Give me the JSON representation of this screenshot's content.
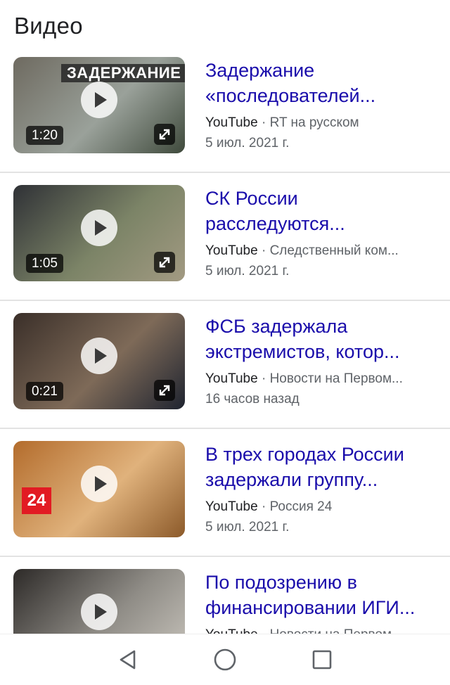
{
  "section_title": "Видео",
  "videos": [
    {
      "title": "Задержание «последователей...",
      "source": "YouTube",
      "channel": "RT на русском",
      "date": "5 июл. 2021 г.",
      "duration": "1:20",
      "banner": "ЗАДЕРЖАНИЕ",
      "thumb_colors": [
        "#6e6a60",
        "#9aa19a",
        "#3f4a3c"
      ]
    },
    {
      "title": "СК России расследуются...",
      "source": "YouTube",
      "channel": "Следственный ком...",
      "date": "5 июл. 2021 г.",
      "duration": "1:05",
      "banner": "",
      "thumb_colors": [
        "#2f3136",
        "#7c8467",
        "#a29a82"
      ]
    },
    {
      "title": "ФСБ задержала экстремистов, котор...",
      "source": "YouTube",
      "channel": "Новости на Первом...",
      "date": "16 часов назад",
      "duration": "0:21",
      "banner": "",
      "thumb_colors": [
        "#3a2f29",
        "#7e6a58",
        "#1f2430"
      ]
    },
    {
      "title": "В трех городах России задержали группу...",
      "source": "YouTube",
      "channel": "Россия 24",
      "date": "5 июл. 2021 г.",
      "duration": "",
      "banner": "",
      "badge": "24",
      "thumb_colors": [
        "#b36c2c",
        "#e0b27c",
        "#8c5a2a"
      ]
    },
    {
      "title": "По подозрению в финансировании ИГИ...",
      "source": "YouTube",
      "channel": "Новости на Первом...",
      "date": "",
      "duration": "",
      "banner": "",
      "thumb_colors": [
        "#2d2a28",
        "#8f8c86",
        "#c9c5bd"
      ]
    }
  ],
  "meta_separator": " · ",
  "navbar": {
    "icons": [
      "back-icon",
      "home-icon",
      "recents-icon"
    ]
  }
}
